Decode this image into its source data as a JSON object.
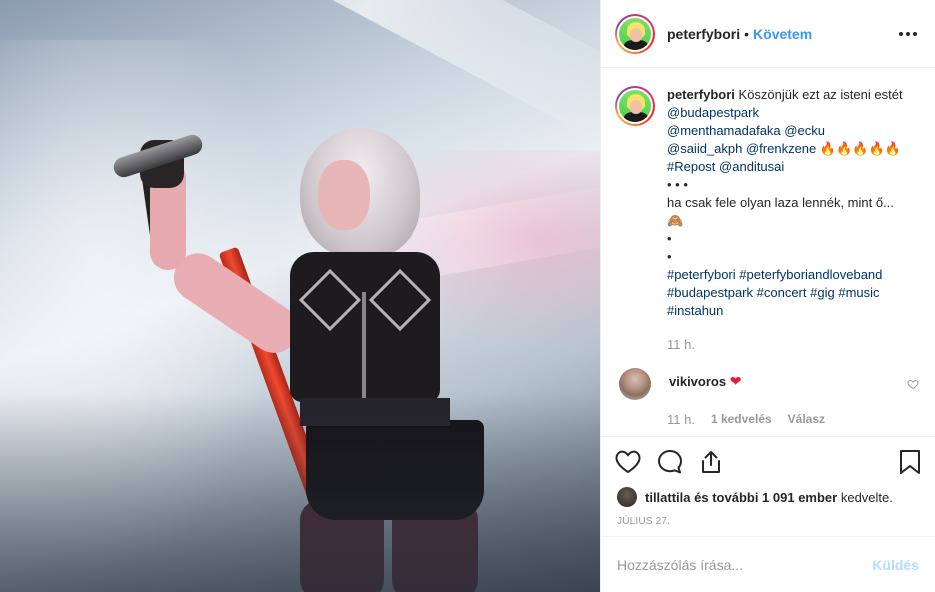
{
  "header": {
    "username": "peterfybori",
    "separator": "•",
    "follow_label": "Követem",
    "more_icon": "more-horizontal-icon"
  },
  "caption": {
    "username": "peterfybori",
    "text_1": "Köszönjük ezt az isteni estét",
    "mention_1": "@budapestpark",
    "mention_2": "@menthamadafaka",
    "mention_3": "@ecku",
    "mention_4": "@saiid_akph",
    "mention_5": "@frenkzene",
    "emoji_fire": "🔥🔥🔥🔥🔥",
    "hashtag_repost": "#Repost",
    "mention_6": "@anditusai",
    "dots": "• • •",
    "text_2": "ha csak fele olyan laza lennék, mint ő...",
    "emoji_face": "🙈",
    "bullet_1": "•",
    "bullet_2": "•",
    "hashtags": [
      "#peterfybori",
      "#peterfyboriandloveband",
      "#budapestpark",
      "#concert",
      "#gig",
      "#music",
      "#instahun"
    ],
    "time": "11 h."
  },
  "reply": {
    "username": "vikivoros",
    "emoji": "❤",
    "time": "11 h.",
    "likes": "1 kedvelés",
    "reply_label": "Válasz"
  },
  "likes": {
    "user": "tillattila",
    "rest_bold": "és további 1 091 ember",
    "suffix": "kedvelte."
  },
  "date": "JÚLIUS 27.",
  "add_comment": {
    "placeholder": "Hozzászólás írása...",
    "send_label": "Küldés"
  },
  "colors": {
    "follow_blue": "#3897f0",
    "hashtag_blue": "#003569",
    "send_disabled": "#b2dffc",
    "heart_red": "#e01e3c"
  },
  "icons": [
    "heart-icon",
    "comment-icon",
    "share-icon",
    "bookmark-icon",
    "small-heart-icon"
  ]
}
